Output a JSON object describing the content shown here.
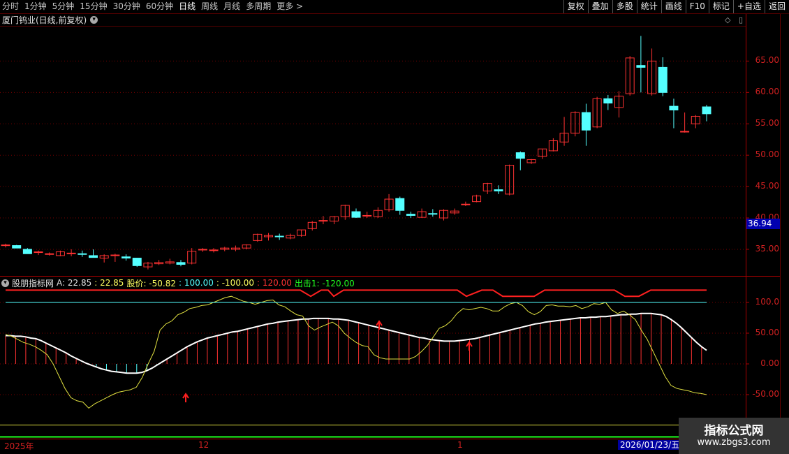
{
  "toolbar": {
    "left_items": [
      "分时",
      "1分钟",
      "5分钟",
      "15分钟",
      "30分钟",
      "60分钟",
      "日线",
      "周线",
      "月线",
      "多周期",
      "更多 >"
    ],
    "active_index": 6,
    "right_items": [
      "复权",
      "叠加",
      "多股",
      "统计",
      "画线",
      "F10",
      "标记",
      "+自选",
      "返回"
    ]
  },
  "stock": {
    "title": "厦门钨业(日线,前复权)"
  },
  "price_axis": [
    "65.00",
    "60.00",
    "55.00",
    "50.00",
    "45.00",
    "40.00",
    "35.00"
  ],
  "last_price": "36.94",
  "indicator": {
    "name": "股朋指标网",
    "a_label": "A: 22.85",
    "val2": ": 22.85",
    "price_label": "股价: -50.82",
    "val100": ": 100.00",
    "valm100": ": -100.00",
    "val120": ": 120.00",
    "exit_label": "出击1: -120.00"
  },
  "ind_axis": [
    "100.0",
    "50.00",
    "0.00",
    "-50.00"
  ],
  "dates": {
    "a": "2025年",
    "b": "12",
    "c": "1",
    "selected": "2026/01/23/五"
  },
  "watermark": {
    "line1": "指标公式网",
    "line2": "www.zbgs3.com"
  },
  "colors": {
    "up": "#ff3232",
    "down": "#54ffff",
    "grid": "#7a0000"
  },
  "chart_data": {
    "type": "candlestick",
    "candles": [
      [
        35.6,
        35.9,
        35.3,
        35.7
      ],
      [
        35.6,
        35.7,
        35.2,
        35.2
      ],
      [
        35.0,
        35.2,
        34.3,
        34.3
      ],
      [
        34.5,
        34.8,
        34.1,
        34.6
      ],
      [
        34.3,
        34.5,
        34.0,
        34.3
      ],
      [
        34.0,
        34.8,
        33.9,
        34.6
      ],
      [
        34.4,
        35.0,
        33.9,
        34.4
      ],
      [
        34.3,
        34.8,
        33.8,
        34.2
      ],
      [
        34.0,
        35.0,
        33.8,
        33.7
      ],
      [
        33.6,
        34.2,
        32.9,
        34.0
      ],
      [
        34.0,
        34.3,
        33.0,
        34.1
      ],
      [
        33.8,
        34.2,
        33.2,
        33.6
      ],
      [
        33.6,
        32.6,
        32.2,
        32.4
      ],
      [
        32.2,
        33.0,
        31.8,
        32.8
      ],
      [
        32.7,
        33.3,
        32.5,
        32.9
      ],
      [
        32.8,
        33.5,
        32.6,
        33.0
      ],
      [
        32.9,
        33.3,
        32.3,
        32.6
      ],
      [
        32.8,
        35.2,
        32.6,
        34.7
      ],
      [
        34.9,
        35.2,
        34.6,
        35.0
      ],
      [
        34.8,
        35.2,
        34.5,
        34.9
      ],
      [
        35.0,
        35.4,
        34.7,
        35.2
      ],
      [
        35.0,
        35.6,
        34.7,
        35.2
      ],
      [
        35.2,
        35.8,
        35.0,
        35.7
      ],
      [
        36.4,
        37.5,
        36.2,
        37.4
      ],
      [
        37.0,
        37.6,
        36.4,
        37.2
      ],
      [
        37.1,
        37.5,
        36.5,
        37.0
      ],
      [
        36.8,
        37.5,
        36.6,
        37.2
      ],
      [
        37.2,
        38.1,
        37.0,
        38.1
      ],
      [
        38.3,
        39.5,
        38.0,
        39.3
      ],
      [
        39.5,
        40.3,
        39.0,
        39.6
      ],
      [
        39.5,
        40.3,
        39.0,
        40.2
      ],
      [
        40.2,
        42.1,
        39.7,
        42.0
      ],
      [
        41.0,
        41.5,
        40.0,
        40.1
      ],
      [
        40.3,
        41.0,
        40.0,
        40.4
      ],
      [
        40.2,
        41.7,
        40.0,
        41.2
      ],
      [
        41.3,
        43.8,
        41.0,
        43.0
      ],
      [
        43.1,
        43.4,
        40.5,
        41.2
      ],
      [
        40.6,
        41.0,
        40.0,
        40.4
      ],
      [
        40.1,
        41.5,
        40.0,
        41.0
      ],
      [
        40.7,
        41.4,
        40.2,
        40.6
      ],
      [
        40.0,
        41.4,
        39.6,
        41.2
      ],
      [
        40.8,
        41.5,
        40.5,
        41.1
      ],
      [
        42.1,
        42.6,
        41.9,
        42.2
      ],
      [
        42.6,
        43.7,
        42.5,
        43.5
      ],
      [
        44.3,
        45.6,
        43.8,
        45.5
      ],
      [
        44.5,
        45.2,
        43.8,
        44.3
      ],
      [
        43.8,
        48.5,
        43.6,
        48.4
      ],
      [
        50.4,
        50.6,
        47.6,
        49.5
      ],
      [
        48.8,
        49.4,
        48.6,
        49.3
      ],
      [
        49.8,
        51.0,
        49.4,
        51.0
      ],
      [
        50.7,
        52.7,
        50.6,
        52.3
      ],
      [
        52.1,
        56.1,
        51.5,
        53.5
      ],
      [
        53.5,
        57.0,
        53.0,
        56.8
      ],
      [
        56.8,
        58.2,
        51.5,
        54.0
      ],
      [
        54.5,
        59.3,
        54.3,
        59.0
      ],
      [
        59.0,
        59.6,
        57.2,
        58.3
      ],
      [
        57.6,
        60.2,
        56.0,
        59.4
      ],
      [
        59.8,
        65.8,
        59.5,
        65.5
      ],
      [
        64.3,
        69.0,
        60.0,
        64.0
      ],
      [
        59.8,
        67.0,
        59.5,
        65.0
      ],
      [
        64.0,
        65.6,
        59.4,
        60.0
      ],
      [
        57.8,
        59.0,
        54.3,
        57.2
      ],
      [
        53.7,
        56.8,
        53.6,
        53.8
      ],
      [
        55.0,
        56.4,
        54.3,
        56.2
      ],
      [
        57.7,
        58.0,
        55.4,
        56.6
      ]
    ],
    "indicator_A": [
      46,
      46,
      45,
      45,
      44,
      42,
      41,
      38,
      34,
      30,
      26,
      22,
      18,
      13,
      9,
      5,
      1,
      -2,
      -5,
      -8,
      -10,
      -12,
      -13,
      -14,
      -15,
      -15,
      -15,
      -14,
      -11,
      -7,
      -2,
      3,
      8,
      13,
      18,
      23,
      28,
      32,
      36,
      39,
      42,
      44,
      46,
      48,
      50,
      52,
      53,
      55,
      57,
      59,
      61,
      63,
      65,
      66,
      68,
      69,
      70,
      71,
      72,
      73,
      73,
      74,
      74,
      74,
      74,
      73,
      73,
      72,
      71,
      69,
      67,
      65,
      63,
      61,
      59,
      57,
      55,
      53,
      51,
      49,
      47,
      45,
      43,
      42,
      40,
      39,
      38,
      37,
      37,
      37,
      38,
      39,
      40,
      41,
      43,
      45,
      47,
      49,
      51,
      53,
      55,
      57,
      59,
      61,
      63,
      65,
      66,
      68,
      69,
      70,
      71,
      72,
      73,
      74,
      75,
      75,
      76,
      76,
      77,
      77,
      78,
      79,
      80,
      80,
      81,
      81,
      82,
      82,
      82,
      81,
      80,
      77,
      72,
      66,
      59,
      51,
      43,
      35,
      28,
      22
    ]
  }
}
